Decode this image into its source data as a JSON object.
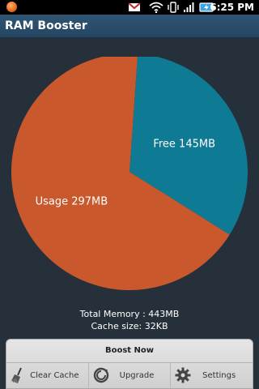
{
  "status_bar": {
    "time": "6:25 PM",
    "icons": [
      "notification-dot-icon",
      "gmail-icon",
      "wifi-icon",
      "vibrate-icon",
      "signal-icon",
      "battery-charging-icon"
    ]
  },
  "app": {
    "title": "RAM Booster"
  },
  "chart_data": {
    "type": "pie",
    "slices": [
      {
        "label": "Usage 297MB",
        "value": 297,
        "color": "#ca582d"
      },
      {
        "label": "Free 145MB",
        "value": 145,
        "color": "#0e7a93"
      }
    ]
  },
  "info": {
    "total_memory": "Total Memory : 443MB",
    "cache_size": "Cache size: 32KB"
  },
  "actions": {
    "boost_now": "Boost Now",
    "clear_cache": "Clear Cache",
    "upgrade": "Upgrade",
    "settings": "Settings"
  },
  "colors": {
    "background": "#25303a",
    "title_bar": "#2a4e6b",
    "usage": "#ca582d",
    "free": "#0e7a93"
  }
}
